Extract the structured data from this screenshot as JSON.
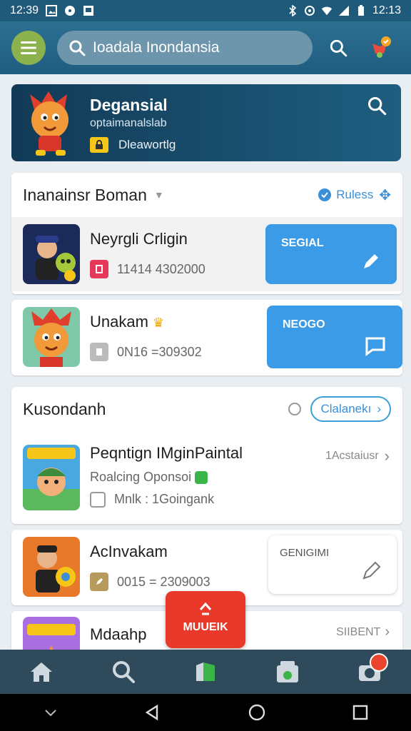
{
  "status_bar": {
    "time_left": "12:39",
    "time_right": "12:13"
  },
  "header": {
    "search_text": "Ioadala Inondansia"
  },
  "banner": {
    "title": "Degansial",
    "subtitle": "optaimanalslab",
    "tag_label": "Dleawortlg"
  },
  "section1": {
    "title": "Inanainsr Boman",
    "action_label": "Ruless",
    "items": [
      {
        "name": "Neyrgli Crligin",
        "meta": "11414 4302000",
        "action_label": "SEGIAL"
      },
      {
        "name": "Unakam",
        "meta": "0N16 =309302",
        "action_label": "NEOGO"
      }
    ]
  },
  "section2": {
    "title": "Kusondanh",
    "action_label": "Clalanekı",
    "items": [
      {
        "name": "Peqntign IMginPaintal",
        "sub": "Roalcing Oponsoi",
        "meta": "Mnlk : 1Goingank",
        "link": "1Acstaiusr"
      },
      {
        "name": "AcInvakam",
        "meta": "0015 = 2309003",
        "action_label": "GENIGIMI"
      },
      {
        "name": "Mdaahp",
        "link": "SIIBENT"
      }
    ]
  },
  "fab": {
    "label": "MUUEIK"
  },
  "colors": {
    "accent_blue": "#3c9be6",
    "appbar": "#2b6f91",
    "fab_red": "#e8392b",
    "nav_bg": "#2f4a5a"
  },
  "icons": [
    "menu-icon",
    "search-icon",
    "notification-icon",
    "home-icon",
    "compass-icon",
    "bookmark-icon",
    "store-icon",
    "camera-icon",
    "pencil-icon",
    "chat-icon"
  ]
}
